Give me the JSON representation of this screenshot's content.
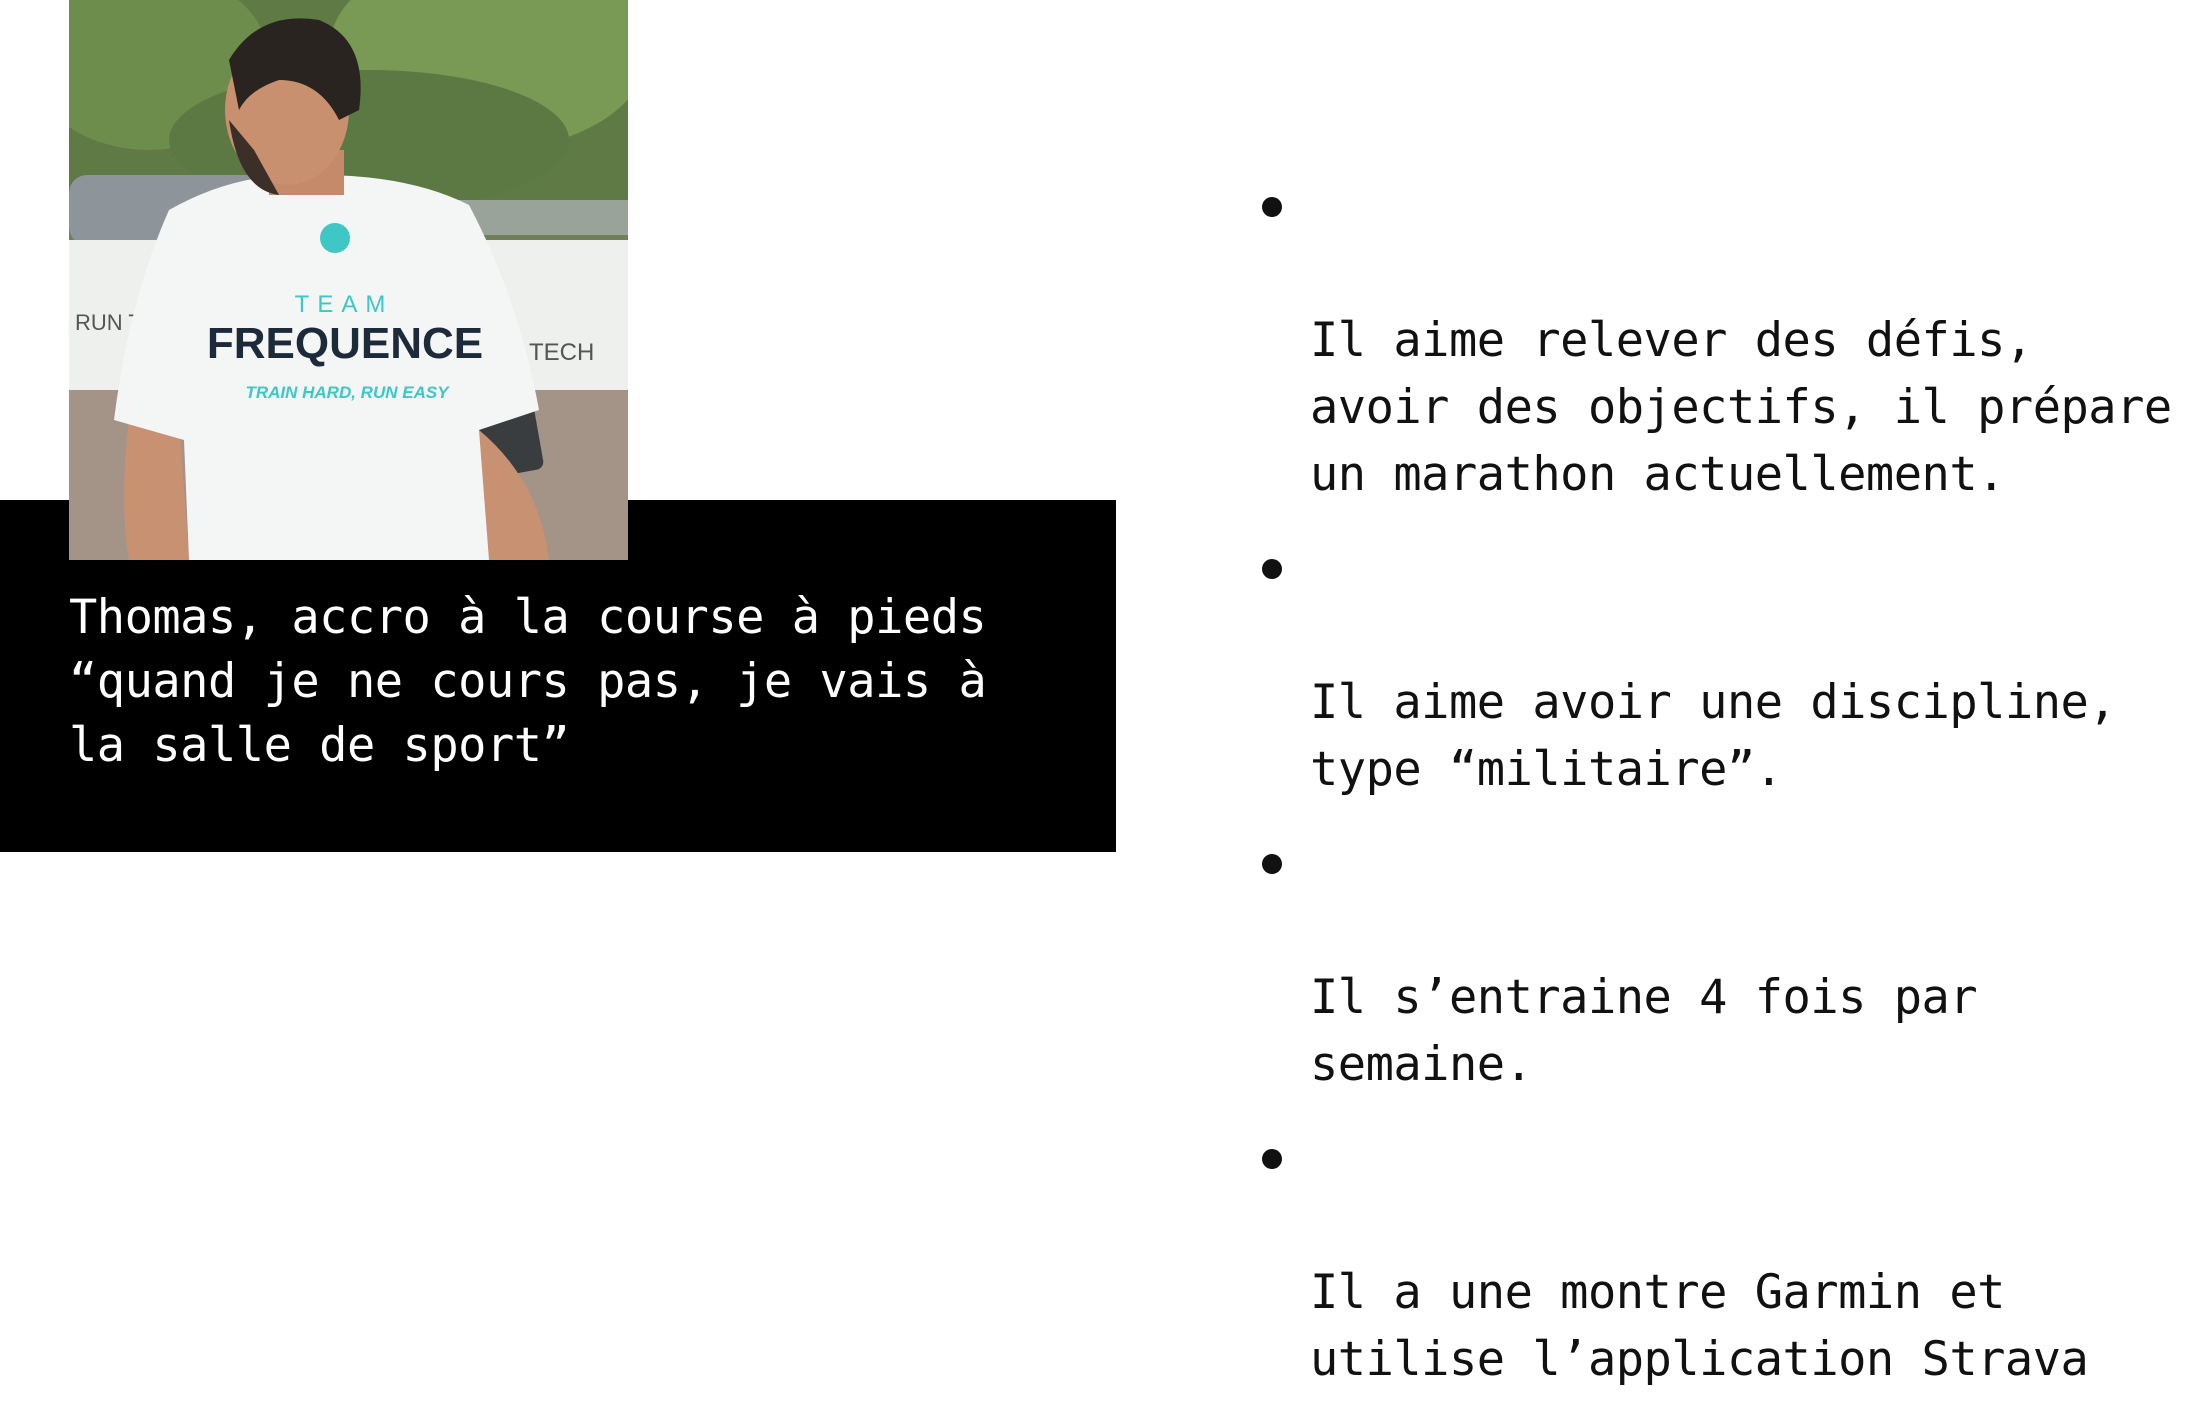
{
  "caption": {
    "text": "Thomas, accro à la course à pieds\n“quand je ne cours pas, je vais à\nla salle de sport”"
  },
  "photo": {
    "shirt_team": "TEAM",
    "shirt_brand": "FREQUENCE",
    "shirt_tagline": "TRAIN HARD, RUN EASY",
    "banner_left": "RUN T",
    "banner_right": "TECH"
  },
  "bullets": [
    {
      "text": "Il aime relever des défis,\navoir des objectifs, il prépare\nun marathon actuellement."
    },
    {
      "text": "Il aime avoir une discipline,\ntype “militaire”."
    },
    {
      "text": "Il s’entraine 4 fois par\nsemaine."
    },
    {
      "text": "Il a une montre Garmin et\nutilise l’application Strava"
    }
  ],
  "colors": {
    "caption_background": "#000000",
    "caption_text": "#ffffff",
    "shirt_accent": "#3ec7c4",
    "shirt_brand": "#1c2a3a"
  }
}
